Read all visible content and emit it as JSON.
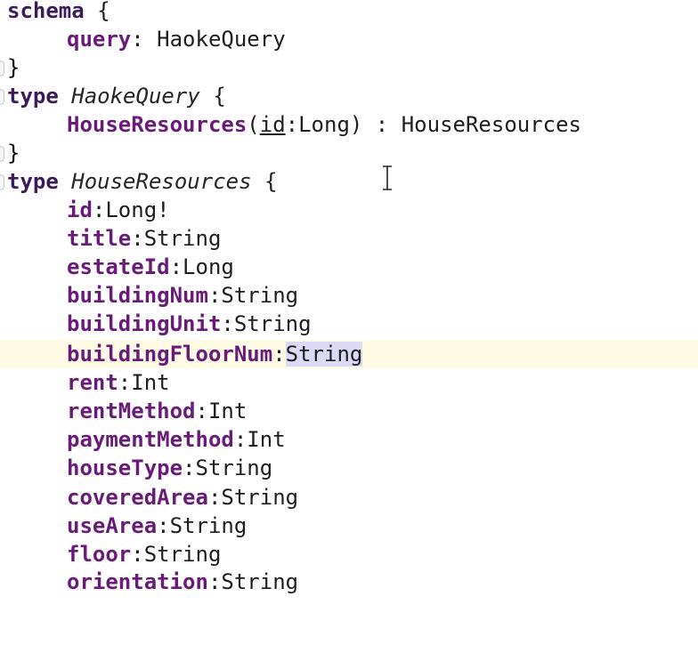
{
  "editor": {
    "schema_line": {
      "keyword": "schema",
      "brace": "{"
    },
    "schema_query": {
      "field": "query",
      "colon": ":",
      "type": "HaokeQuery"
    },
    "schema_close": "}",
    "query_type_line": {
      "keyword": "type",
      "name": "HaokeQuery",
      "brace": "{"
    },
    "query_field": {
      "field": "HouseResources",
      "paren_open": "(",
      "arg_name": "id",
      "arg_colon": ":",
      "arg_type": "Long",
      "paren_close": ")",
      "colon": " : ",
      "type": "HouseResources"
    },
    "query_close": "}",
    "house_type_line": {
      "keyword": "type",
      "name": "HouseResources",
      "brace": "{"
    },
    "fields": [
      {
        "name": "id",
        "type": "Long!"
      },
      {
        "name": "title",
        "type": "String"
      },
      {
        "name": "estateId",
        "type": "Long"
      },
      {
        "name": "buildingNum",
        "type": "String"
      },
      {
        "name": "buildingUnit",
        "type": "String"
      },
      {
        "name": "buildingFloorNum",
        "type": "String"
      },
      {
        "name": "rent",
        "type": "Int"
      },
      {
        "name": "rentMethod",
        "type": "Int"
      },
      {
        "name": "paymentMethod",
        "type": "Int"
      },
      {
        "name": "houseType",
        "type": "String"
      },
      {
        "name": "coveredArea",
        "type": "String"
      },
      {
        "name": "useArea",
        "type": "String"
      },
      {
        "name": "floor",
        "type": "String"
      },
      {
        "name": "orientation",
        "type": "String"
      }
    ]
  }
}
